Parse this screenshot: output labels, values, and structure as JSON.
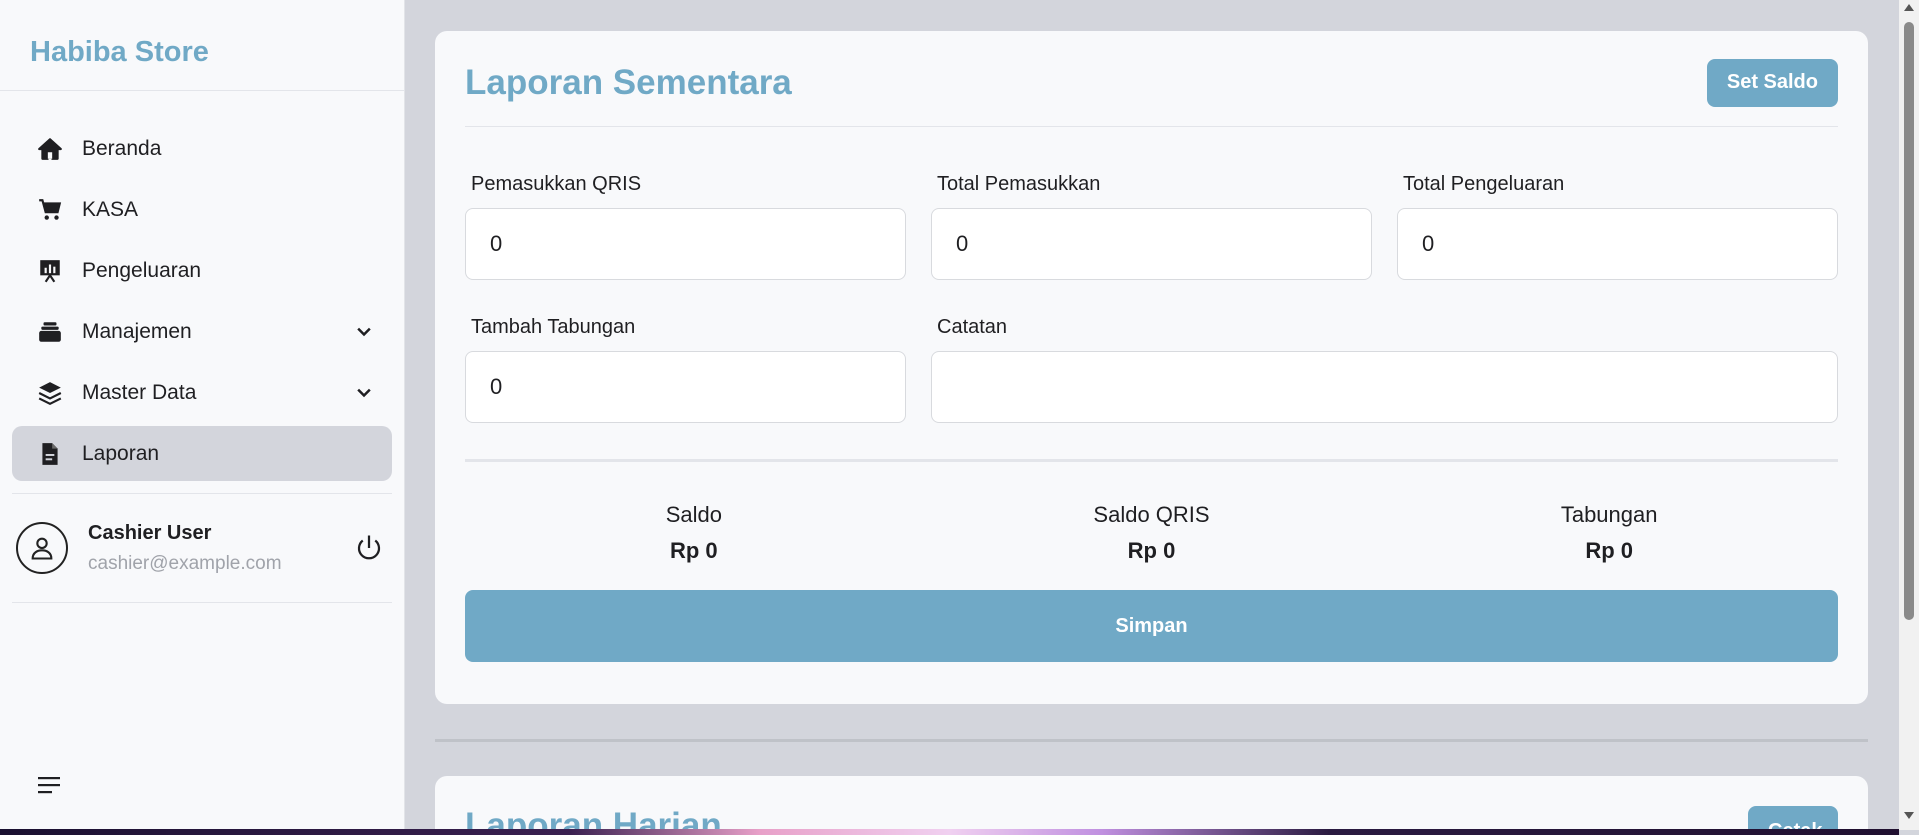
{
  "sidebar": {
    "brand": "Habiba Store",
    "items": [
      {
        "label": "Beranda",
        "icon": "home-icon"
      },
      {
        "label": "KASA",
        "icon": "cart-icon"
      },
      {
        "label": "Pengeluaran",
        "icon": "chart-board-icon"
      },
      {
        "label": "Manajemen",
        "icon": "stack-icon",
        "expandable": true
      },
      {
        "label": "Master Data",
        "icon": "layers-icon",
        "expandable": true
      },
      {
        "label": "Laporan",
        "icon": "document-icon",
        "active": true
      }
    ],
    "user": {
      "name": "Cashier User",
      "email": "cashier@example.com"
    }
  },
  "card": {
    "title": "Laporan Sementara",
    "set_saldo_label": "Set Saldo",
    "fields": {
      "pemasukkan_qris": {
        "label": "Pemasukkan QRIS",
        "value": "0"
      },
      "total_pemasukkan": {
        "label": "Total Pemasukkan",
        "value": "0"
      },
      "total_pengeluaran": {
        "label": "Total Pengeluaran",
        "value": "0"
      },
      "tambah_tabungan": {
        "label": "Tambah Tabungan",
        "value": "0"
      },
      "catatan": {
        "label": "Catatan",
        "value": ""
      }
    },
    "stats": {
      "saldo": {
        "label": "Saldo",
        "value": "Rp 0"
      },
      "saldo_qris": {
        "label": "Saldo QRIS",
        "value": "Rp 0"
      },
      "tabungan": {
        "label": "Tabungan",
        "value": "Rp 0"
      }
    },
    "save_label": "Simpan"
  },
  "card2": {
    "title": "Laporan Harian",
    "button_label": "Cetak"
  },
  "colors": {
    "accent": "#70a9c6",
    "background": "#d3d5dc",
    "card": "#f8f9fb",
    "active_nav": "#d3d5dc"
  }
}
